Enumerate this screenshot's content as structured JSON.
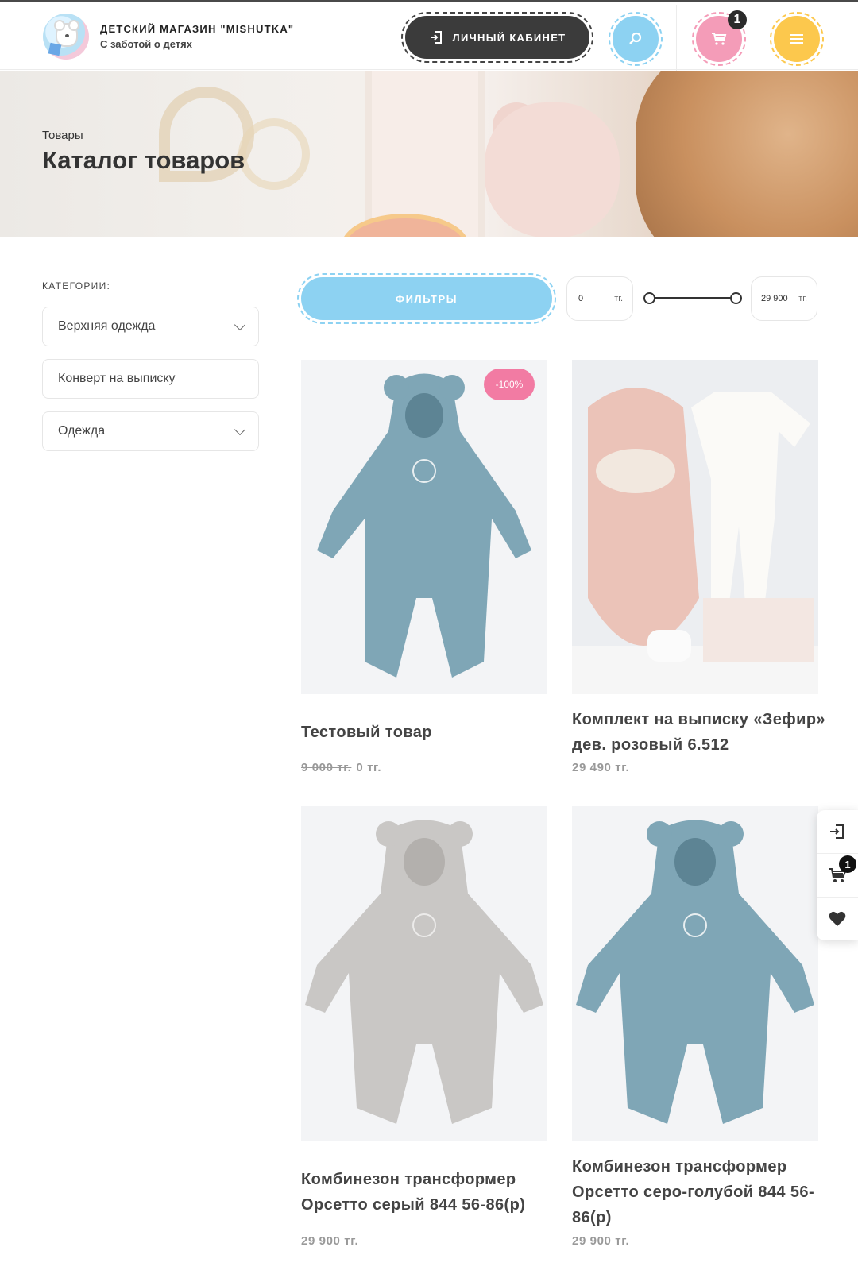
{
  "header": {
    "brand_name": "ДЕТСКИЙ МАГАЗИН \"MISHUTKA\"",
    "brand_tagline": "С заботой о детях",
    "account_label": "ЛИЧНЫЙ КАБИНЕТ",
    "cart_count": "1"
  },
  "hero": {
    "breadcrumb": "Товары",
    "title": "Каталог товаров"
  },
  "sidebar": {
    "label": "КАТЕГОРИИ:",
    "items": [
      {
        "label": "Верхняя одежда",
        "has_dropdown": true
      },
      {
        "label": "Конверт на выписку",
        "has_dropdown": false
      },
      {
        "label": "Одежда",
        "has_dropdown": true
      }
    ]
  },
  "filters": {
    "button_label": "ФИЛЬТРЫ",
    "price_min": "0",
    "price_max": "29 900",
    "currency": "тг."
  },
  "products": [
    {
      "title": "Тестовый товар",
      "old_price": "9 000 тг.",
      "price": "0 тг.",
      "badge": "-100%",
      "image_color": "#7fa6b6"
    },
    {
      "title": "Комплект на выписку «Зефир» дев. розовый 6.512",
      "price": "29 490 тг.",
      "image_color": "#ebc3b8"
    },
    {
      "title": "Комбинезон трансформер Орсетто серый 844 56-86(р)",
      "price": "29 900 тг.",
      "image_color": "#c9c7c5"
    },
    {
      "title": "Комбинезон трансформер Орсетто серо-голубой 844 56-86(р)",
      "price": "29 900 тг.",
      "image_color": "#7fa6b6"
    }
  ],
  "side_panel": {
    "cart_count": "1"
  },
  "colors": {
    "accent_blue": "#8dd2f2",
    "accent_pink": "#f49cb8",
    "accent_yellow": "#fcc84d",
    "dark_button": "#3b3b3b",
    "sale_badge": "#f27ba3"
  }
}
